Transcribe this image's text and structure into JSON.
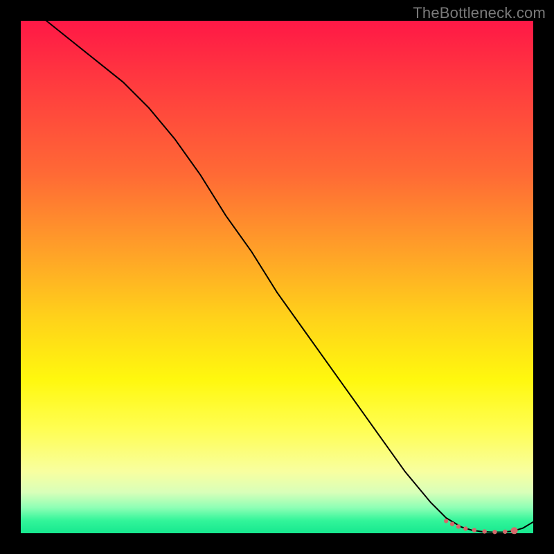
{
  "watermark": "TheBottleneck.com",
  "chart_data": {
    "type": "line",
    "title": "",
    "xlabel": "",
    "ylabel": "",
    "xlim": [
      0,
      100
    ],
    "ylim": [
      0,
      100
    ],
    "grid": false,
    "legend": false,
    "series": [
      {
        "name": "curve",
        "color": "#000000",
        "x": [
          0,
          5,
          10,
          15,
          20,
          25,
          30,
          35,
          40,
          45,
          50,
          55,
          60,
          65,
          70,
          75,
          80,
          83,
          86,
          88,
          90,
          92,
          94,
          96,
          98,
          100
        ],
        "y": [
          104,
          100,
          96,
          92,
          88,
          83,
          77,
          70,
          62,
          55,
          47,
          40,
          33,
          26,
          19,
          12,
          6,
          3,
          1.2,
          0.6,
          0.3,
          0.2,
          0.2,
          0.4,
          1.0,
          2.2
        ]
      }
    ],
    "dots": {
      "name": "bottom-dots",
      "color": "#d4686a",
      "radius_small": 3.2,
      "radius_end": 5.0,
      "points": [
        {
          "x": 83.0,
          "y": 2.4,
          "r": 3.2
        },
        {
          "x": 84.2,
          "y": 1.8,
          "r": 3.2
        },
        {
          "x": 85.4,
          "y": 1.3,
          "r": 3.2
        },
        {
          "x": 86.8,
          "y": 0.9,
          "r": 3.2
        },
        {
          "x": 88.5,
          "y": 0.6,
          "r": 3.2
        },
        {
          "x": 90.5,
          "y": 0.35,
          "r": 3.2
        },
        {
          "x": 92.5,
          "y": 0.25,
          "r": 3.2
        },
        {
          "x": 94.5,
          "y": 0.3,
          "r": 3.2
        },
        {
          "x": 96.3,
          "y": 0.5,
          "r": 5.0
        }
      ]
    },
    "background_gradient_stops": [
      {
        "pos": 0.0,
        "color": "#ff1846"
      },
      {
        "pos": 0.3,
        "color": "#ff6a35"
      },
      {
        "pos": 0.58,
        "color": "#ffd21a"
      },
      {
        "pos": 0.8,
        "color": "#fffe55"
      },
      {
        "pos": 0.95,
        "color": "#8effb5"
      },
      {
        "pos": 1.0,
        "color": "#16e88f"
      }
    ]
  }
}
